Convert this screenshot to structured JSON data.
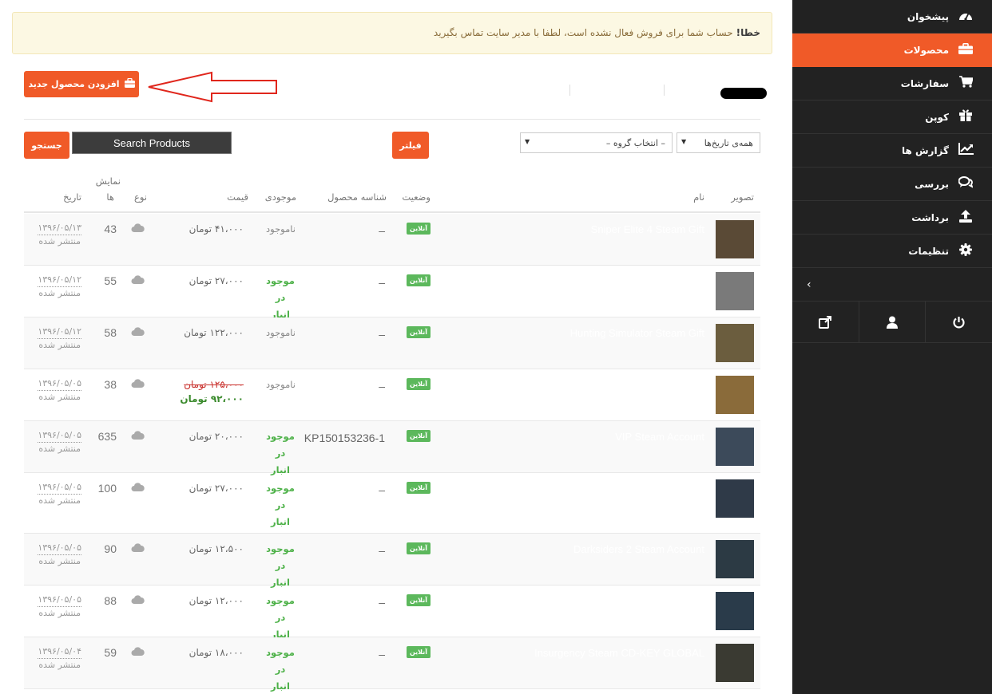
{
  "notice": {
    "strong": "خطا!",
    "text": "حساب شما برای فروش فعال نشده است، لطفا با مدیر سایت تماس بگیرید"
  },
  "toolbar": {
    "add_label": "افزودن محصول جدید"
  },
  "filters": {
    "date_select": "همه‌ی تاریخ‌ها",
    "category_select": "– انتخاب گروه –",
    "filter_label": "فیلتر",
    "search_placeholder": "Search Products",
    "search_label": "جستجو"
  },
  "sidebar": {
    "items": [
      {
        "label": "پیشخوان",
        "icon": "dashboard-icon",
        "active": false
      },
      {
        "label": "محصولات",
        "icon": "briefcase-icon",
        "active": true
      },
      {
        "label": "سفارشات",
        "icon": "cart-icon",
        "active": false
      },
      {
        "label": "کوپن",
        "icon": "gift-icon",
        "active": false
      },
      {
        "label": "گزارش ها",
        "icon": "chart-icon",
        "active": false
      },
      {
        "label": "بررسی",
        "icon": "comments-icon",
        "active": false
      },
      {
        "label": "برداشت",
        "icon": "upload-icon",
        "active": false
      },
      {
        "label": "تنظیمات",
        "icon": "gear-icon",
        "active": false
      }
    ],
    "footer_icons": [
      "external-link-icon",
      "user-icon",
      "power-icon"
    ]
  },
  "table": {
    "headers": {
      "image": "تصویر",
      "name": "نام",
      "status": "وضعیت",
      "sku": "شناسه محصول",
      "stock": "موجودی",
      "price": "قیمت",
      "type": "نوع",
      "views_1": "نمایش",
      "views_2": "ها",
      "date": "تاریخ"
    },
    "rows": [
      {
        "name": "Sniper Elite 4 Steam Gift",
        "status": "آنلاین",
        "sku": "–",
        "stock": "ناموجود",
        "in_stock": false,
        "price": "۴۱،۰۰۰ تومان",
        "views": "43",
        "date": "۱۳۹۶/۰۵/۱۳",
        "date_status": "منتشر شده",
        "thumb": "#5a4a36"
      },
      {
        "name": "",
        "status": "آنلاین",
        "sku": "–",
        "stock": "موجود در انبار",
        "in_stock": true,
        "price": "۲۷،۰۰۰ تومان",
        "views": "55",
        "date": "۱۳۹۶/۰۵/۱۲",
        "date_status": "منتشر شده",
        "thumb": "#7a7a7a"
      },
      {
        "name": "Hunting Simulator Steam Gift",
        "status": "آنلاین",
        "sku": "–",
        "stock": "ناموجود",
        "in_stock": false,
        "price": "۱۲۲،۰۰۰ تومان",
        "views": "58",
        "date": "۱۳۹۶/۰۵/۱۲",
        "date_status": "منتشر شده",
        "thumb": "#6b5d3e"
      },
      {
        "name": "",
        "status": "آنلاین",
        "sku": "–",
        "stock": "ناموجود",
        "in_stock": false,
        "price_old": "۱۲۵،۰۰۰ تومان",
        "price_new": "۹۲،۰۰۰ تومان",
        "views": "38",
        "date": "۱۳۹۶/۰۵/۰۵",
        "date_status": "منتشر شده",
        "thumb": "#8a6b3a"
      },
      {
        "name": "VIP Steam Account",
        "status": "آنلاین",
        "sku": "KP150153236-1",
        "stock": "موجود در انبار",
        "in_stock": true,
        "price": "۲۰،۰۰۰ تومان",
        "views": "635",
        "date": "۱۳۹۶/۰۵/۰۵",
        "date_status": "منتشر شده",
        "thumb": "#3c4a5a"
      },
      {
        "name": "",
        "status": "آنلاین",
        "sku": "–",
        "stock": "موجود در انبار",
        "in_stock": true,
        "price": "۲۷،۰۰۰ تومان",
        "views": "100",
        "date": "۱۳۹۶/۰۵/۰۵",
        "date_status": "منتشر شده",
        "thumb": "#2f3a48"
      },
      {
        "name": "Darksiders 2 Steam Account",
        "status": "آنلاین",
        "sku": "–",
        "stock": "موجود در انبار",
        "in_stock": true,
        "price": "۱۲،۵۰۰ تومان",
        "views": "90",
        "date": "۱۳۹۶/۰۵/۰۵",
        "date_status": "منتشر شده",
        "thumb": "#2c3a44"
      },
      {
        "name": "",
        "status": "آنلاین",
        "sku": "–",
        "stock": "موجود در انبار",
        "in_stock": true,
        "price": "۱۲،۰۰۰ تومان",
        "views": "88",
        "date": "۱۳۹۶/۰۵/۰۵",
        "date_status": "منتشر شده",
        "thumb": "#2a3b4a"
      },
      {
        "name": "Insurgency Steam CD-KEY GLOBAL",
        "status": "آنلاین",
        "sku": "–",
        "stock": "موجود در انبار",
        "in_stock": true,
        "price": "۱۸،۰۰۰ تومان",
        "views": "59",
        "date": "۱۳۹۶/۰۵/۰۴",
        "date_status": "منتشر شده",
        "thumb": "#3a3a32"
      }
    ]
  }
}
